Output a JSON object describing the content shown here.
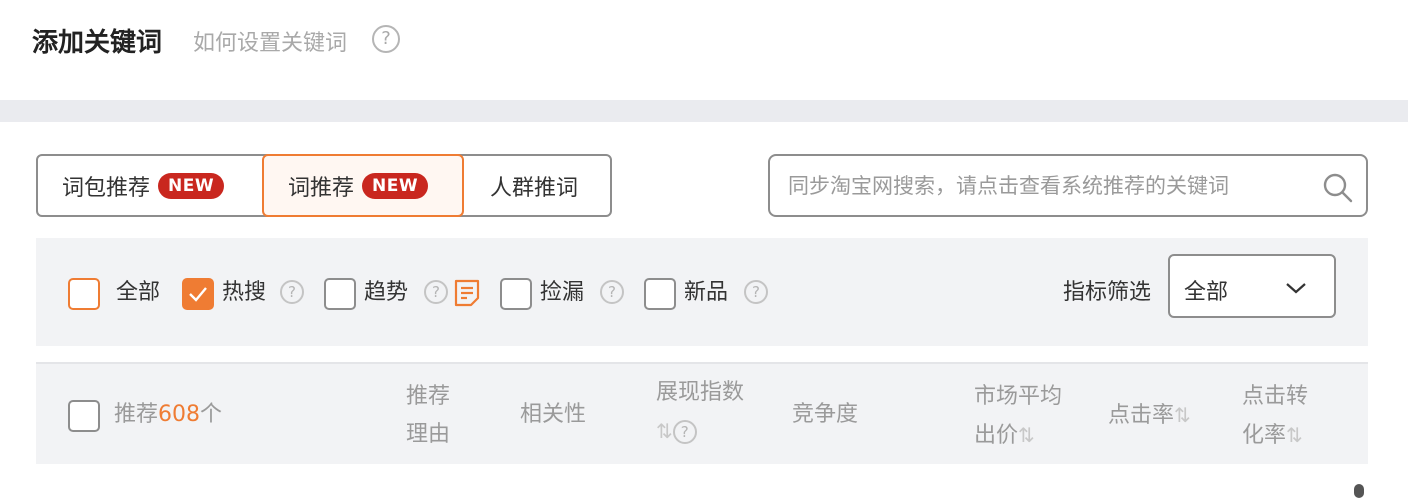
{
  "header": {
    "title": "添加关键词",
    "help_link": "如何设置关键词",
    "help_icon": "?"
  },
  "tabs": [
    {
      "label": "词包推荐",
      "badge": "NEW",
      "active": false
    },
    {
      "label": "词推荐",
      "badge": "NEW",
      "active": true
    },
    {
      "label": "人群推词",
      "active": false
    }
  ],
  "search": {
    "placeholder": "同步淘宝网搜索，请点击查看系统推荐的关键词",
    "value": ""
  },
  "filters": {
    "options": [
      {
        "label": "全部",
        "checked": false
      },
      {
        "label": "热搜",
        "checked": true
      },
      {
        "label": "趋势",
        "checked": false
      },
      {
        "label": "捡漏",
        "checked": false
      },
      {
        "label": "新品",
        "checked": false
      }
    ],
    "help_icon": "?",
    "metric_label": "指标筛选",
    "metric_value": "全部"
  },
  "table": {
    "recommend_prefix": "推荐",
    "recommend_count": "608",
    "recommend_suffix": "个",
    "columns": {
      "reason_line1": "推荐",
      "reason_line2": "理由",
      "relevance": "相关性",
      "impression_index": "展现指数",
      "competition": "竞争度",
      "avg_price_line1": "市场平均",
      "avg_price_line2": "出价",
      "ctr": "点击率",
      "cvr_line1": "点击转",
      "cvr_line2": "化率"
    },
    "sort_glyph": "⇅"
  },
  "colors": {
    "accent": "#ef7c33",
    "badge": "#c9271f",
    "panel": "#f2f3f5"
  }
}
